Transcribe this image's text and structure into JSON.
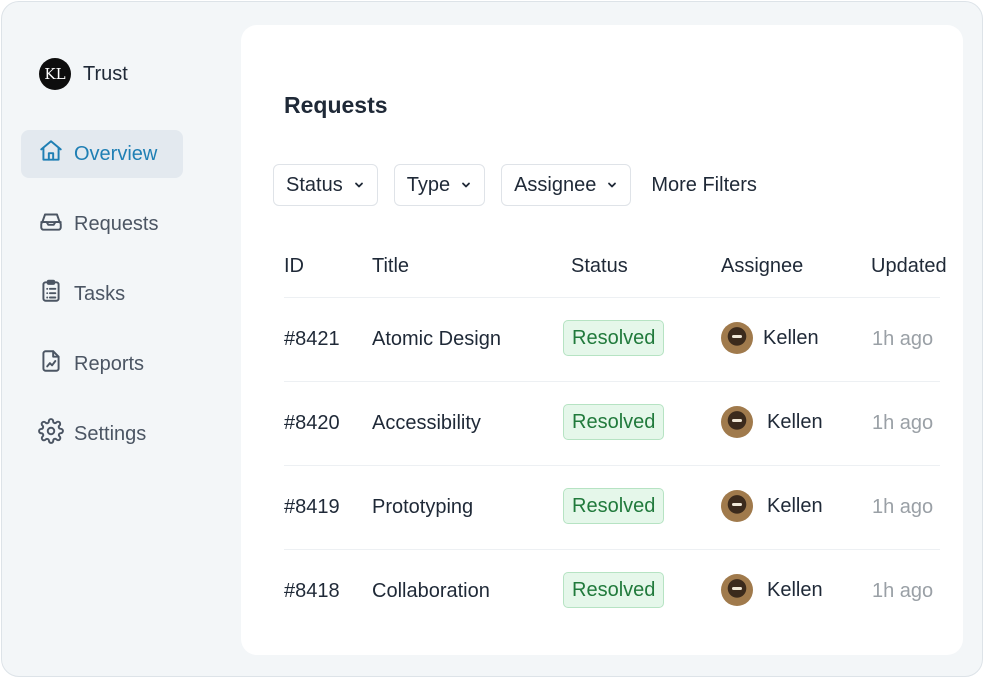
{
  "brand": {
    "logo_text": "KL",
    "name": "Trust"
  },
  "sidebar": {
    "items": [
      {
        "label": "Overview",
        "icon": "home-icon",
        "active": true
      },
      {
        "label": "Requests",
        "icon": "inbox-icon",
        "active": false
      },
      {
        "label": "Tasks",
        "icon": "clipboard-list-icon",
        "active": false
      },
      {
        "label": "Reports",
        "icon": "report-chart-icon",
        "active": false
      },
      {
        "label": "Settings",
        "icon": "gear-icon",
        "active": false
      }
    ]
  },
  "main": {
    "title": "Requests",
    "filters": [
      {
        "label": "Status"
      },
      {
        "label": "Type"
      },
      {
        "label": "Assignee"
      }
    ],
    "more_filters": "More Filters",
    "table": {
      "columns": [
        "ID",
        "Title",
        "Status",
        "Assignee",
        "Updated"
      ],
      "rows": [
        {
          "id": "#8421",
          "title": "Atomic Design",
          "status": "Resolved",
          "assignee": "Kellen",
          "updated": "1h ago"
        },
        {
          "id": "#8420",
          "title": "Accessibility",
          "status": "Resolved",
          "assignee": "Kellen",
          "updated": "1h ago"
        },
        {
          "id": "#8419",
          "title": "Prototyping",
          "status": "Resolved",
          "assignee": "Kellen",
          "updated": "1h ago"
        },
        {
          "id": "#8418",
          "title": "Collaboration",
          "status": "Resolved",
          "assignee": "Kellen",
          "updated": "1h ago"
        }
      ]
    }
  },
  "colors": {
    "accent": "#1f7fb4",
    "badge_bg": "#e5f7ea",
    "badge_text": "#217a3c",
    "muted_text": "#9aa0a6"
  }
}
